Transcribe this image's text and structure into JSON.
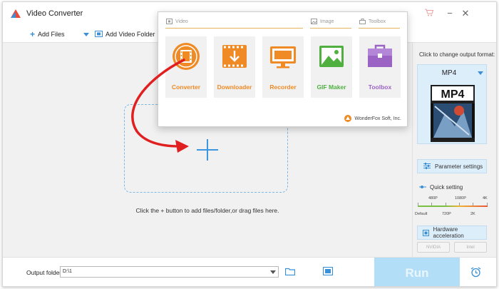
{
  "window": {
    "title": "Video Converter"
  },
  "toolbar": {
    "add_files": "Add Files",
    "add_video_folder": "Add Video Folder"
  },
  "main": {
    "hint": "Click the + button to add files/folder,or drag files here."
  },
  "popup": {
    "sections": {
      "video": "Video",
      "image": "Image",
      "toolbox": "Toolbox"
    },
    "tiles": [
      {
        "label": "Converter",
        "color": "#f08a24",
        "icon": "film-reel-icon"
      },
      {
        "label": "Downloader",
        "color": "#f08a24",
        "icon": "download-icon"
      },
      {
        "label": "Recorder",
        "color": "#f08a24",
        "icon": "monitor-record-icon"
      },
      {
        "label": "GIF Maker",
        "color": "#4fb040",
        "icon": "image-icon"
      },
      {
        "label": "Toolbox",
        "color": "#9b63c4",
        "icon": "toolbox-icon"
      }
    ],
    "brand": "WonderFox Soft, Inc."
  },
  "right_panel": {
    "change_format_label": "Click to change output format:",
    "format": "MP4",
    "format_thumb_text": "MP4",
    "parameter_settings": "Parameter settings",
    "quick_setting": "Quick setting",
    "quality_top": [
      "480P",
      "1080P",
      "4K"
    ],
    "quality_bottom": [
      "Default",
      "720P",
      "2K"
    ],
    "hardware_acceleration": "Hardware acceleration",
    "hw_options": [
      "NVIDIA",
      "Intel"
    ]
  },
  "bottom": {
    "output_folder_label": "Output folder:",
    "output_folder_value": "D:\\1",
    "run": "Run"
  },
  "colors": {
    "accent_blue": "#3d97e0",
    "arrow_red": "#e02020",
    "run_bg": "#b3def7"
  }
}
